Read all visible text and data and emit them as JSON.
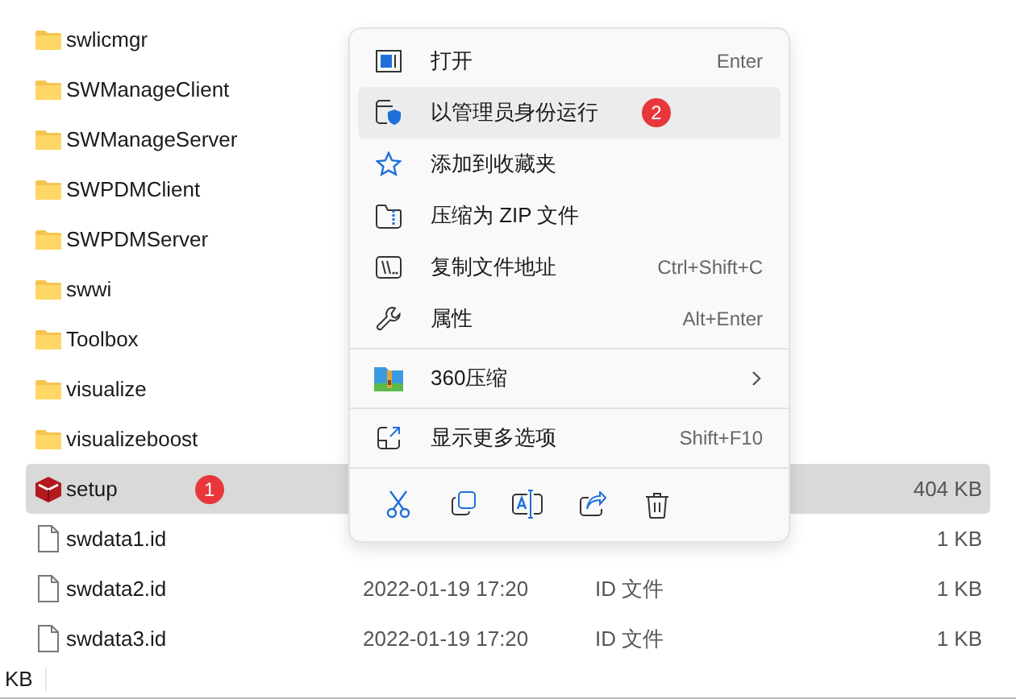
{
  "files": [
    {
      "name": "swlicmgr",
      "kind": "folder",
      "selected": false
    },
    {
      "name": "SWManageClient",
      "kind": "folder",
      "selected": false
    },
    {
      "name": "SWManageServer",
      "kind": "folder",
      "selected": false
    },
    {
      "name": "SWPDMClient",
      "kind": "folder",
      "selected": false
    },
    {
      "name": "SWPDMServer",
      "kind": "folder",
      "selected": false
    },
    {
      "name": "swwi",
      "kind": "folder",
      "selected": false
    },
    {
      "name": "Toolbox",
      "kind": "folder",
      "selected": false
    },
    {
      "name": "visualize",
      "kind": "folder",
      "selected": false
    },
    {
      "name": "visualizeboost",
      "kind": "folder",
      "selected": false
    },
    {
      "name": "setup",
      "kind": "app",
      "selected": true,
      "size": "404 KB",
      "badge": "1"
    },
    {
      "name": "swdata1.id",
      "kind": "file",
      "selected": false,
      "size": "1 KB"
    },
    {
      "name": "swdata2.id",
      "kind": "file",
      "selected": false,
      "date": "2022-01-19 17:20",
      "type": "ID 文件",
      "size": "1 KB"
    },
    {
      "name": "swdata3.id",
      "kind": "file",
      "selected": false,
      "date": "2022-01-19 17:20",
      "type": "ID 文件",
      "size": "1 KB"
    }
  ],
  "status_bar": {
    "text": "KB"
  },
  "context_menu": {
    "items": [
      {
        "label": "打开",
        "shortcut": "Enter",
        "selected": false
      },
      {
        "label": "以管理员身份运行",
        "selected": true,
        "badge": "2"
      },
      {
        "label": "添加到收藏夹",
        "selected": false
      },
      {
        "label": "压缩为 ZIP 文件",
        "selected": false
      },
      {
        "label": "复制文件地址",
        "shortcut": "Ctrl+Shift+C",
        "selected": false
      },
      {
        "label": "属性",
        "shortcut": "Alt+Enter",
        "selected": false,
        "separator_after": true
      },
      {
        "label": "360压缩",
        "selected": false,
        "submenu": true,
        "separator_after": true
      },
      {
        "label": "显示更多选项",
        "shortcut": "Shift+F10",
        "selected": false,
        "separator_after": true
      }
    ]
  }
}
